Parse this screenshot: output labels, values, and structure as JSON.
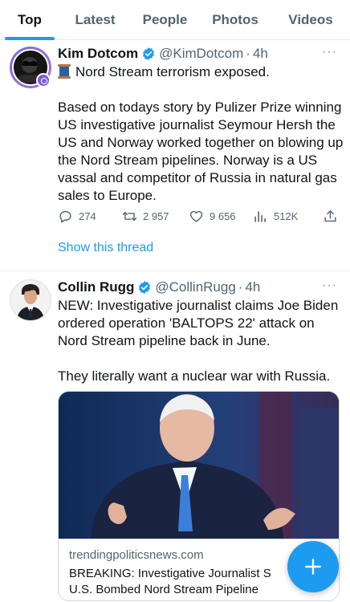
{
  "tabs": [
    {
      "label": "Top",
      "active": true
    },
    {
      "label": "Latest"
    },
    {
      "label": "People"
    },
    {
      "label": "Photos"
    },
    {
      "label": "Videos"
    }
  ],
  "tweets": [
    {
      "name": "Kim Dotcom",
      "handle": "@KimDotcom",
      "separator": "·",
      "time": "4h",
      "more": "···",
      "text_lines": [
        "Nord Stream terrorism exposed.",
        "",
        "Based on todays story by Pulizer Prize winning",
        "US investigative journalist Seymour Hersh the",
        "US and Norway worked together on blowing up",
        "the Nord Stream pipelines. Norway is a US",
        "vassal and competitor of Russia in natural gas",
        "sales to Europe."
      ],
      "leading_emoji": "spool-of-thread-emoji",
      "replies": "274",
      "retweets": "2 957",
      "likes": "9 656",
      "views": "512K",
      "show_thread": "Show this thread"
    },
    {
      "name": "Collin Rugg",
      "handle": "@CollinRugg",
      "separator": "·",
      "time": "4h",
      "more": "···",
      "text_lines": [
        "NEW: Investigative journalist claims Joe Biden",
        "ordered operation 'BALTOPS 22' attack on",
        "Nord Stream pipeline back in June.",
        "",
        "They literally want a nuclear war with Russia."
      ],
      "card": {
        "domain": "trendingpoliticsnews.com",
        "title_lines": [
          "BREAKING: Investigative Journalist S",
          "U.S. Bombed Nord Stream Pipeline"
        ]
      }
    }
  ],
  "icons": {
    "verified": "verified-badge-icon",
    "reply": "reply-icon",
    "retweet": "retweet-icon",
    "like": "heart-icon",
    "views": "views-icon",
    "share": "share-icon",
    "compose": "plus-icon"
  },
  "colors": {
    "accent": "#1d9bf0",
    "text": "#0f1419",
    "secondary": "#536471",
    "border": "#e6ecf0"
  }
}
